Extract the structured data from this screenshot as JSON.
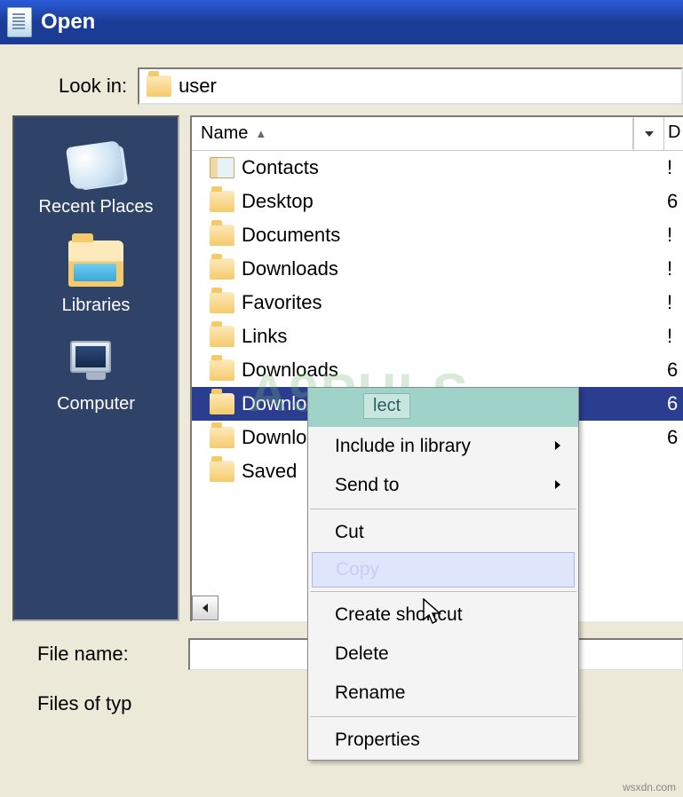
{
  "window": {
    "title": "Open"
  },
  "lookin": {
    "label": "Look in:",
    "value": "user"
  },
  "sidebar": {
    "items": [
      {
        "label": "Recent Places"
      },
      {
        "label": "Libraries"
      },
      {
        "label": "Computer"
      }
    ]
  },
  "columns": {
    "name": "Name",
    "next_initial": "D"
  },
  "files": [
    {
      "name": "Contacts",
      "type": "contacts",
      "trail": "!"
    },
    {
      "name": "Desktop",
      "type": "folder",
      "trail": "6"
    },
    {
      "name": "Documents",
      "type": "folder",
      "trail": "!"
    },
    {
      "name": "Downloads",
      "type": "folder",
      "trail": "!"
    },
    {
      "name": "Favorites",
      "type": "folder",
      "trail": "!"
    },
    {
      "name": "Links",
      "type": "folder",
      "trail": "!"
    },
    {
      "name": "Downloads",
      "type": "folder",
      "trail": "6"
    },
    {
      "name": "Downloads",
      "type": "folder",
      "trail": "6",
      "selected": true
    },
    {
      "name": "Downloads",
      "type": "folder",
      "trail": "6"
    },
    {
      "name": "Saved",
      "type": "folder",
      "trail": ""
    }
  ],
  "bottom": {
    "filename_label": "File name:",
    "filetype_label": "Files of typ"
  },
  "context_menu": {
    "items": [
      {
        "label": "lect",
        "kind": "first"
      },
      {
        "label": "Include in library",
        "submenu": true
      },
      {
        "label": "Send to",
        "submenu": true
      },
      {
        "kind": "sep"
      },
      {
        "label": "Cut"
      },
      {
        "label": "Copy",
        "kind": "hover"
      },
      {
        "kind": "sep"
      },
      {
        "label": "Create shortcut"
      },
      {
        "label": "Delete"
      },
      {
        "label": "Rename"
      },
      {
        "kind": "sep"
      },
      {
        "label": "Properties"
      }
    ]
  },
  "watermark": "A9PULS",
  "source": "wsxdn.com"
}
